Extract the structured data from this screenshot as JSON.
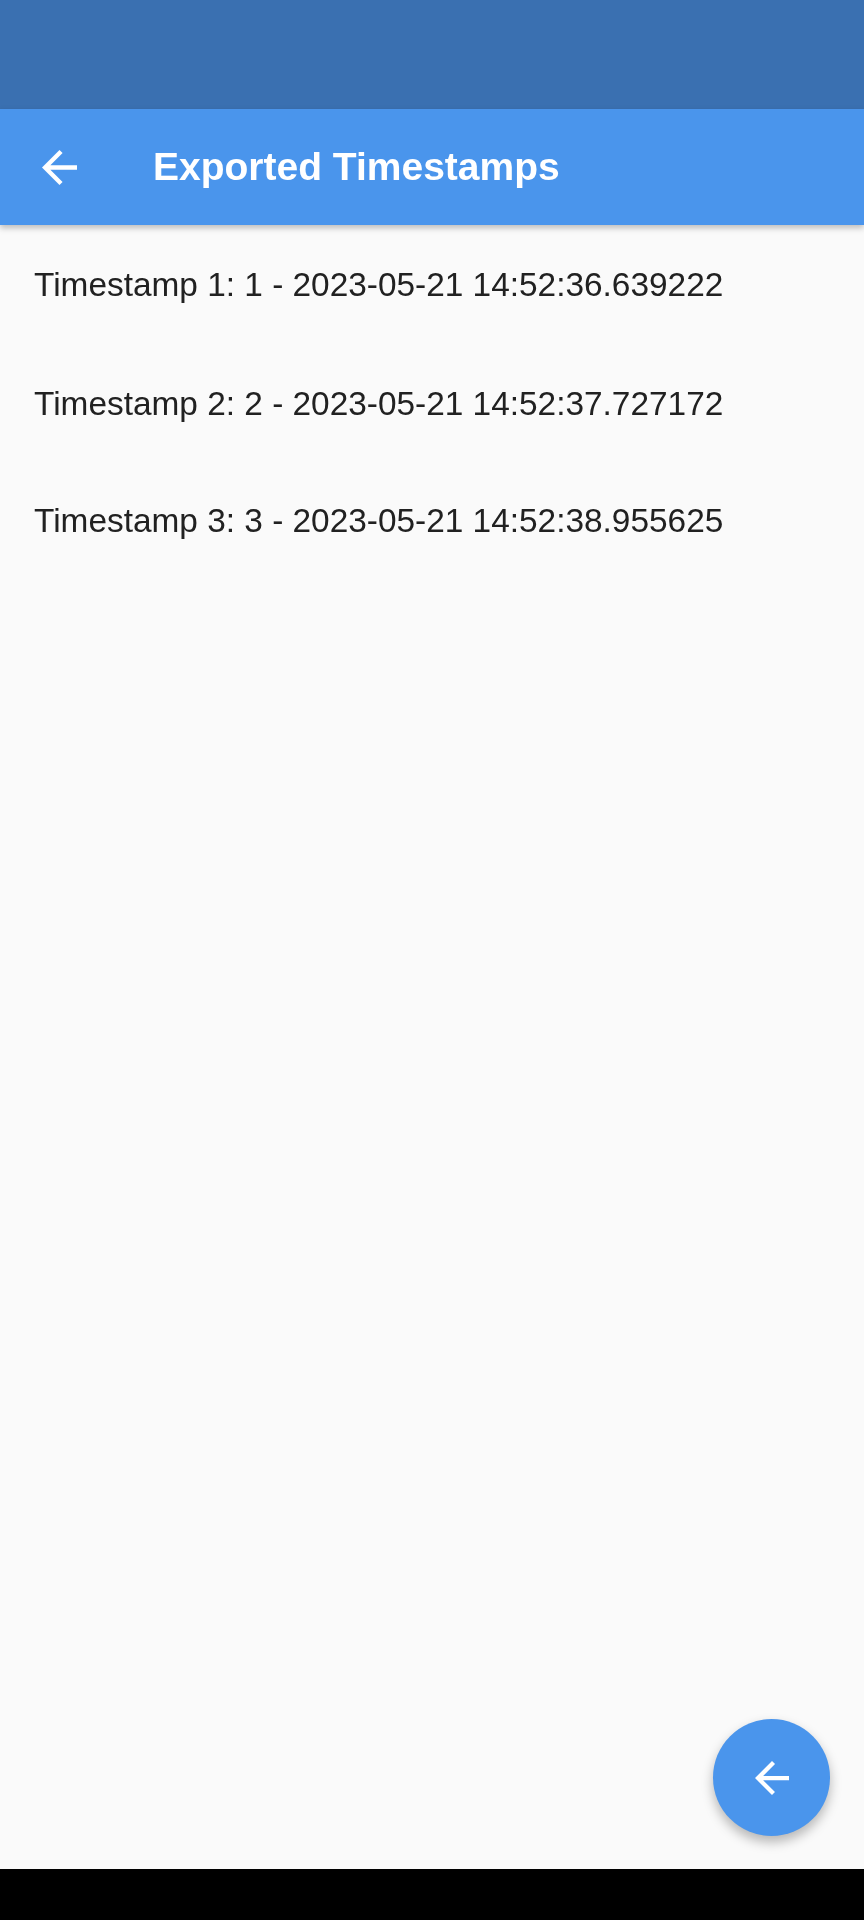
{
  "app_bar": {
    "title": "Exported Timestamps"
  },
  "timestamps": [
    {
      "label": "Timestamp 1: 1 - 2023-05-21 14:52:36.639222"
    },
    {
      "label": "Timestamp 2: 2 - 2023-05-21 14:52:37.727172"
    },
    {
      "label": "Timestamp 3: 3 - 2023-05-21 14:52:38.955625"
    }
  ]
}
